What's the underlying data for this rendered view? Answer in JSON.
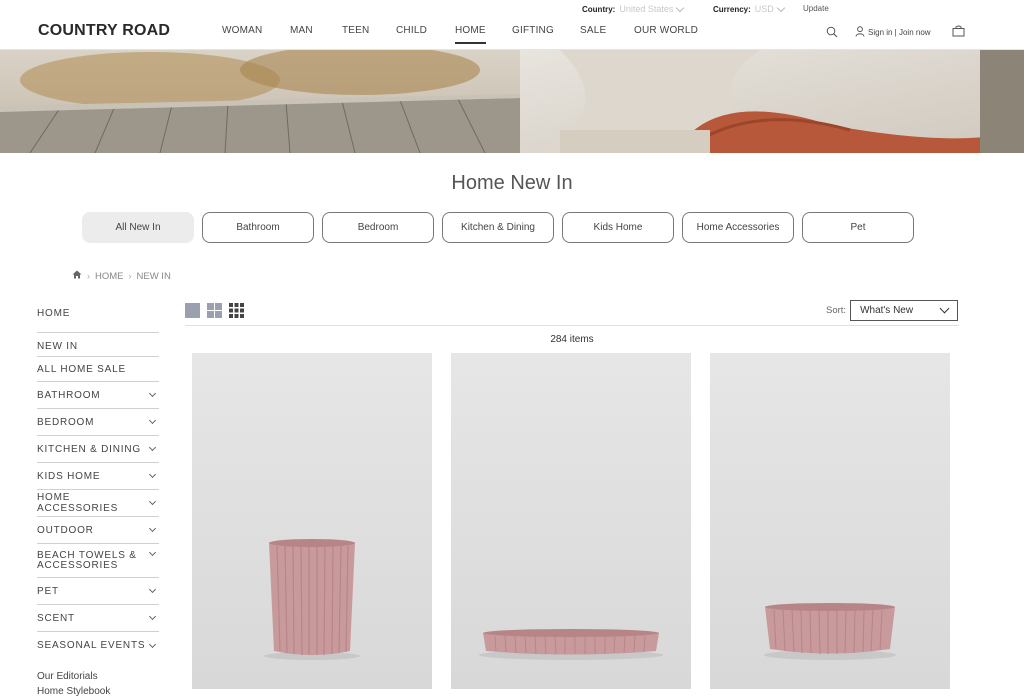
{
  "topbar": {
    "country_label": "Country:",
    "country_value": "United States",
    "currency_label": "Currency:",
    "currency_value": "USD",
    "update_label": "Update"
  },
  "header": {
    "logo": "COUNTRY ROAD",
    "nav": [
      "WOMAN",
      "MAN",
      "TEEN",
      "CHILD",
      "HOME",
      "GIFTING",
      "SALE",
      "OUR WORLD"
    ],
    "active_nav": "HOME",
    "signin_label": "Sign in | Join now"
  },
  "page": {
    "title": "Home New In"
  },
  "category_pills": [
    "All New In",
    "Bathroom",
    "Bedroom",
    "Kitchen & Dining",
    "Kids Home",
    "Home Accessories",
    "Pet"
  ],
  "breadcrumb": [
    "HOME",
    "NEW IN"
  ],
  "sidebar": {
    "title": "HOME",
    "items": [
      {
        "label": "NEW IN",
        "expandable": false
      },
      {
        "label": "ALL HOME SALE",
        "expandable": false
      },
      {
        "label": "BATHROOM",
        "expandable": true
      },
      {
        "label": "BEDROOM",
        "expandable": true
      },
      {
        "label": "KITCHEN & DINING",
        "expandable": true
      },
      {
        "label": "KIDS HOME",
        "expandable": true
      },
      {
        "label": "HOME ACCESSORIES",
        "expandable": true
      },
      {
        "label": "OUTDOOR",
        "expandable": true
      },
      {
        "label": "BEACH TOWELS & ACCESSORIES",
        "expandable": true
      },
      {
        "label": "PET",
        "expandable": true
      },
      {
        "label": "SCENT",
        "expandable": true
      },
      {
        "label": "SEASONAL EVENTS",
        "expandable": true
      }
    ],
    "links": [
      "Our Editorials",
      "Home Stylebook"
    ]
  },
  "listing": {
    "sort_label": "Sort:",
    "sort_value": "What's New",
    "item_count": "284 items"
  },
  "colors": {
    "product_pink": "#c99a9c",
    "pill_selected_bg": "#ececec"
  }
}
